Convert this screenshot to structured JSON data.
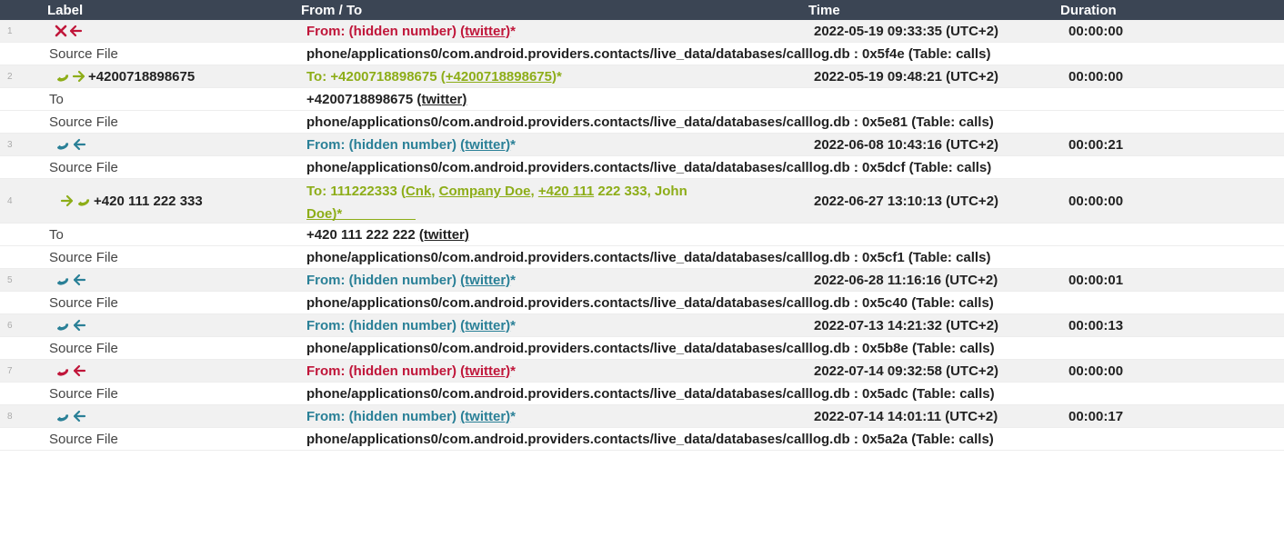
{
  "columns": {
    "label": "Label",
    "from_to": "From / To",
    "time": "Time",
    "duration": "Duration"
  },
  "colors": {
    "header_bg": "#3b4554",
    "missed": "#c0163a",
    "incoming": "#2a8097",
    "outgoing": "#8dad18"
  },
  "records": [
    {
      "num": "1",
      "icons": [
        "missed-x-icon",
        "incoming-arrow-icon"
      ],
      "label": "",
      "from": {
        "prefix": "From: (hidden number) ",
        "link": "(twitter)",
        "suffix": "*"
      },
      "time": "2022-05-19 09:33:35 (UTC+2)",
      "duration": "00:00:00",
      "source_label": "Source File",
      "source": "phone/applications0/com.android.providers.contacts/live_data/databases/calllog.db : 0x5f4e (Table: calls)"
    },
    {
      "num": "2",
      "icons": [
        "phone-icon",
        "outgoing-arrow-icon"
      ],
      "label": "+4200718898675",
      "from": {
        "prefix": "To: +4200718898675 ",
        "link": "(+4200718898675)",
        "suffix": "*"
      },
      "time": "2022-05-19 09:48:21 (UTC+2)",
      "duration": "00:00:00",
      "to_label": "To",
      "to_value": "+4200718898675 ",
      "to_link": "(twitter)",
      "source_label": "Source File",
      "source": "phone/applications0/com.android.providers.contacts/live_data/databases/calllog.db : 0x5e81 (Table: calls)"
    },
    {
      "num": "3",
      "icons": [
        "phone-icon",
        "incoming-arrow-icon"
      ],
      "label": "",
      "from": {
        "prefix": "From: (hidden number) ",
        "link": "(twitter)",
        "suffix": "*"
      },
      "time": "2022-06-08 10:43:16 (UTC+2)",
      "duration": "00:00:21",
      "source_label": "Source File",
      "source": "phone/applications0/com.android.providers.contacts/live_data/databases/calllog.db : 0x5dcf (Table: calls)"
    },
    {
      "num": "4",
      "icons": [
        "outgoing-arrow-icon",
        "phone-icon"
      ],
      "label": "+420 111 222 333",
      "from": {
        "prefix": "To: 111222333 (",
        "link1": "Cnk",
        "sep1": ", ",
        "link2": "Company Doe",
        "sep2": ", ",
        "link3": "+420 111",
        "mid": " 222 333, John",
        "line2": "Doe)*"
      },
      "time": "2022-06-27 13:10:13 (UTC+2)",
      "duration": "00:00:00",
      "to_label": "To",
      "to_value": "+420 111 222 222 ",
      "to_link": "(twitter)",
      "source_label": "Source File",
      "source": "phone/applications0/com.android.providers.contacts/live_data/databases/calllog.db : 0x5cf1 (Table: calls)"
    },
    {
      "num": "5",
      "icons": [
        "phone-icon",
        "incoming-arrow-icon"
      ],
      "label": "",
      "from": {
        "prefix": "From: (hidden number) ",
        "link": "(twitter)",
        "suffix": "*"
      },
      "time": "2022-06-28 11:16:16 (UTC+2)",
      "duration": "00:00:01",
      "source_label": "Source File",
      "source": "phone/applications0/com.android.providers.contacts/live_data/databases/calllog.db : 0x5c40 (Table: calls)"
    },
    {
      "num": "6",
      "icons": [
        "phone-icon",
        "incoming-arrow-icon"
      ],
      "label": "",
      "from": {
        "prefix": "From: (hidden number) ",
        "link": "(twitter)",
        "suffix": "*"
      },
      "time": "2022-07-13 14:21:32 (UTC+2)",
      "duration": "00:00:13",
      "source_label": "Source File",
      "source": "phone/applications0/com.android.providers.contacts/live_data/databases/calllog.db : 0x5b8e (Table: calls)"
    },
    {
      "num": "7",
      "icons": [
        "phone-icon",
        "incoming-arrow-icon"
      ],
      "label": "",
      "from": {
        "prefix": "From: (hidden number) ",
        "link": "(twitter)",
        "suffix": "*"
      },
      "time": "2022-07-14 09:32:58 (UTC+2)",
      "duration": "00:00:00",
      "source_label": "Source File",
      "source": "phone/applications0/com.android.providers.contacts/live_data/databases/calllog.db : 0x5adc (Table: calls)"
    },
    {
      "num": "8",
      "icons": [
        "phone-icon",
        "incoming-arrow-icon"
      ],
      "label": "",
      "from": {
        "prefix": "From: (hidden number) ",
        "link": "(twitter)",
        "suffix": "*"
      },
      "time": "2022-07-14 14:01:11 (UTC+2)",
      "duration": "00:00:17",
      "source_label": "Source File",
      "source": "phone/applications0/com.android.providers.contacts/live_data/databases/calllog.db : 0x5a2a (Table: calls)"
    }
  ]
}
